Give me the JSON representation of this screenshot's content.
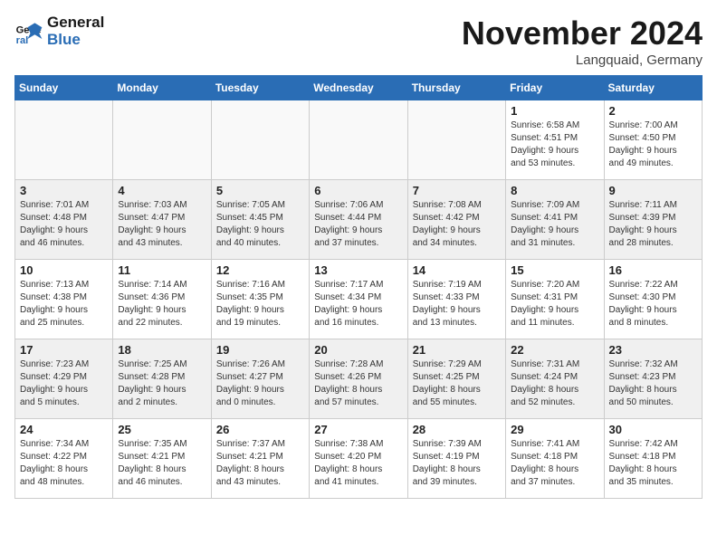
{
  "logo": {
    "line1": "General",
    "line2": "Blue"
  },
  "title": "November 2024",
  "location": "Langquaid, Germany",
  "headers": [
    "Sunday",
    "Monday",
    "Tuesday",
    "Wednesday",
    "Thursday",
    "Friday",
    "Saturday"
  ],
  "weeks": [
    [
      {
        "day": "",
        "info": ""
      },
      {
        "day": "",
        "info": ""
      },
      {
        "day": "",
        "info": ""
      },
      {
        "day": "",
        "info": ""
      },
      {
        "day": "",
        "info": ""
      },
      {
        "day": "1",
        "info": "Sunrise: 6:58 AM\nSunset: 4:51 PM\nDaylight: 9 hours\nand 53 minutes."
      },
      {
        "day": "2",
        "info": "Sunrise: 7:00 AM\nSunset: 4:50 PM\nDaylight: 9 hours\nand 49 minutes."
      }
    ],
    [
      {
        "day": "3",
        "info": "Sunrise: 7:01 AM\nSunset: 4:48 PM\nDaylight: 9 hours\nand 46 minutes."
      },
      {
        "day": "4",
        "info": "Sunrise: 7:03 AM\nSunset: 4:47 PM\nDaylight: 9 hours\nand 43 minutes."
      },
      {
        "day": "5",
        "info": "Sunrise: 7:05 AM\nSunset: 4:45 PM\nDaylight: 9 hours\nand 40 minutes."
      },
      {
        "day": "6",
        "info": "Sunrise: 7:06 AM\nSunset: 4:44 PM\nDaylight: 9 hours\nand 37 minutes."
      },
      {
        "day": "7",
        "info": "Sunrise: 7:08 AM\nSunset: 4:42 PM\nDaylight: 9 hours\nand 34 minutes."
      },
      {
        "day": "8",
        "info": "Sunrise: 7:09 AM\nSunset: 4:41 PM\nDaylight: 9 hours\nand 31 minutes."
      },
      {
        "day": "9",
        "info": "Sunrise: 7:11 AM\nSunset: 4:39 PM\nDaylight: 9 hours\nand 28 minutes."
      }
    ],
    [
      {
        "day": "10",
        "info": "Sunrise: 7:13 AM\nSunset: 4:38 PM\nDaylight: 9 hours\nand 25 minutes."
      },
      {
        "day": "11",
        "info": "Sunrise: 7:14 AM\nSunset: 4:36 PM\nDaylight: 9 hours\nand 22 minutes."
      },
      {
        "day": "12",
        "info": "Sunrise: 7:16 AM\nSunset: 4:35 PM\nDaylight: 9 hours\nand 19 minutes."
      },
      {
        "day": "13",
        "info": "Sunrise: 7:17 AM\nSunset: 4:34 PM\nDaylight: 9 hours\nand 16 minutes."
      },
      {
        "day": "14",
        "info": "Sunrise: 7:19 AM\nSunset: 4:33 PM\nDaylight: 9 hours\nand 13 minutes."
      },
      {
        "day": "15",
        "info": "Sunrise: 7:20 AM\nSunset: 4:31 PM\nDaylight: 9 hours\nand 11 minutes."
      },
      {
        "day": "16",
        "info": "Sunrise: 7:22 AM\nSunset: 4:30 PM\nDaylight: 9 hours\nand 8 minutes."
      }
    ],
    [
      {
        "day": "17",
        "info": "Sunrise: 7:23 AM\nSunset: 4:29 PM\nDaylight: 9 hours\nand 5 minutes."
      },
      {
        "day": "18",
        "info": "Sunrise: 7:25 AM\nSunset: 4:28 PM\nDaylight: 9 hours\nand 2 minutes."
      },
      {
        "day": "19",
        "info": "Sunrise: 7:26 AM\nSunset: 4:27 PM\nDaylight: 9 hours\nand 0 minutes."
      },
      {
        "day": "20",
        "info": "Sunrise: 7:28 AM\nSunset: 4:26 PM\nDaylight: 8 hours\nand 57 minutes."
      },
      {
        "day": "21",
        "info": "Sunrise: 7:29 AM\nSunset: 4:25 PM\nDaylight: 8 hours\nand 55 minutes."
      },
      {
        "day": "22",
        "info": "Sunrise: 7:31 AM\nSunset: 4:24 PM\nDaylight: 8 hours\nand 52 minutes."
      },
      {
        "day": "23",
        "info": "Sunrise: 7:32 AM\nSunset: 4:23 PM\nDaylight: 8 hours\nand 50 minutes."
      }
    ],
    [
      {
        "day": "24",
        "info": "Sunrise: 7:34 AM\nSunset: 4:22 PM\nDaylight: 8 hours\nand 48 minutes."
      },
      {
        "day": "25",
        "info": "Sunrise: 7:35 AM\nSunset: 4:21 PM\nDaylight: 8 hours\nand 46 minutes."
      },
      {
        "day": "26",
        "info": "Sunrise: 7:37 AM\nSunset: 4:21 PM\nDaylight: 8 hours\nand 43 minutes."
      },
      {
        "day": "27",
        "info": "Sunrise: 7:38 AM\nSunset: 4:20 PM\nDaylight: 8 hours\nand 41 minutes."
      },
      {
        "day": "28",
        "info": "Sunrise: 7:39 AM\nSunset: 4:19 PM\nDaylight: 8 hours\nand 39 minutes."
      },
      {
        "day": "29",
        "info": "Sunrise: 7:41 AM\nSunset: 4:18 PM\nDaylight: 8 hours\nand 37 minutes."
      },
      {
        "day": "30",
        "info": "Sunrise: 7:42 AM\nSunset: 4:18 PM\nDaylight: 8 hours\nand 35 minutes."
      }
    ]
  ]
}
